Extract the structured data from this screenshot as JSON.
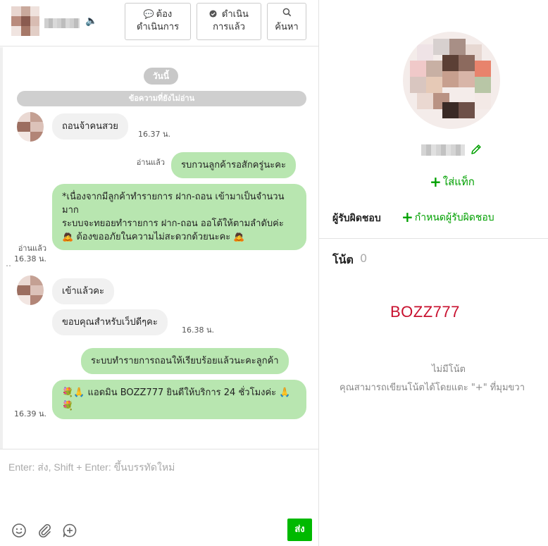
{
  "header": {
    "contact_name": "",
    "buttons": {
      "todo_line1": "ต้อง",
      "todo_line2": "ดำเนินการ",
      "done_line1": "ดำเนิน",
      "done_line2": "การแล้ว",
      "search": "ค้นหา"
    },
    "icons": {
      "sound": "speaker-icon",
      "todo": "speech-bubble-icon",
      "done": "check-bubble-icon",
      "search": "search-icon"
    }
  },
  "chat": {
    "date_pill": "วันนี้",
    "unread_divider": "ข้อความที่ยังไม่อ่าน",
    "messages": [
      {
        "direction": "in",
        "text": "ถอนจ้าคนสวย",
        "time": "16.37 น."
      },
      {
        "direction": "out",
        "text": "รบกวนลูกค้ารอสักครู่นะคะ",
        "status": "อ่านแล้ว"
      },
      {
        "direction": "out",
        "text": "*เนื่องจากมีลูกค้าทำรายการ  ฝาก-ถอน เข้ามาเป็นจำนวนมาก\nระบบจะทยอยทำรายการ  ฝาก-ถอน ออโต้ให้ตามลำดับค่ะ\n🙇 ต้องขออภัยในความไม่สะดวกด้วยนะคะ 🙇",
        "status": "อ่านแล้ว",
        "time": "16.38 น."
      },
      {
        "direction": "in",
        "text": "เข้าแล้วคะ"
      },
      {
        "direction": "in",
        "text": "ขอบคุณสำหรับเว็ปดีๆคะ",
        "time": "16.38 น."
      },
      {
        "direction": "out",
        "text": "ระบบทำรายการถอนให้เรียบร้อยแล้วนะคะลูกค้า"
      },
      {
        "direction": "out",
        "text": "💐🙏  แอดมิน BOZZ777 ยินดีให้บริการ 24 ชั่วโมงค่ะ 🙏 💐",
        "time": "16.39 น."
      }
    ]
  },
  "composer": {
    "placeholder": "Enter: ส่ง, Shift + Enter: ขึ้นบรรทัดใหม่",
    "send_label": "ส่ง",
    "icons": [
      "emoji-icon",
      "attachment-icon",
      "quick-reply-icon"
    ]
  },
  "profile": {
    "name": "",
    "add_tag": "ใส่แท็ก",
    "responsible_label": "ผู้รับผิดชอบ",
    "responsible_action": "กำหนดผู้รับผิดชอบ",
    "notes_label": "โน้ต",
    "notes_count": "0",
    "brand_text": "BOZZ777",
    "no_notes": "ไม่มีโน้ต",
    "no_notes_hint": "คุณสามารถเขียนโน้ตได้โดยแตะ \"+\" ที่มุมขวา"
  },
  "colors": {
    "accent_green": "#00b900",
    "outgoing_bubble": "#b8e6b0",
    "incoming_bubble": "#f1f1f1",
    "brand_red": "#c8102e"
  }
}
